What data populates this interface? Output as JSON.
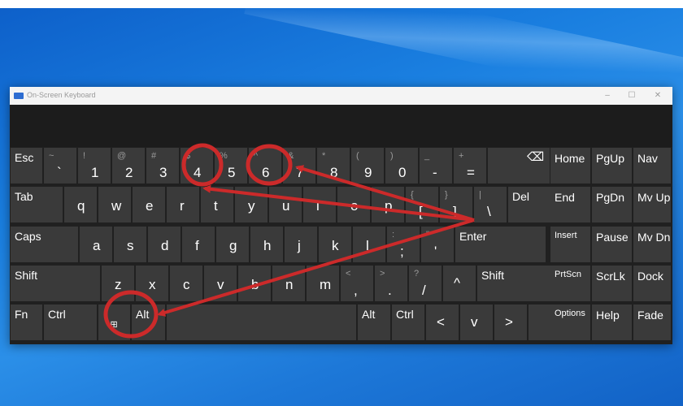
{
  "window": {
    "title": "On-Screen Keyboard",
    "minimize": "–",
    "maximize": "☐",
    "close": "✕"
  },
  "rows": {
    "r1": [
      {
        "name": "key-esc",
        "main": "Esc"
      },
      {
        "name": "key-backtick",
        "main": "`",
        "shift": "~"
      },
      {
        "name": "key-1",
        "main": "1",
        "shift": "!"
      },
      {
        "name": "key-2",
        "main": "2",
        "shift": "@"
      },
      {
        "name": "key-3",
        "main": "3",
        "shift": "#"
      },
      {
        "name": "key-4",
        "main": "4",
        "shift": "$"
      },
      {
        "name": "key-5",
        "main": "5",
        "shift": "%"
      },
      {
        "name": "key-6",
        "main": "6",
        "shift": "^"
      },
      {
        "name": "key-7",
        "main": "7",
        "shift": "&"
      },
      {
        "name": "key-8",
        "main": "8",
        "shift": "*"
      },
      {
        "name": "key-9",
        "main": "9",
        "shift": "("
      },
      {
        "name": "key-0",
        "main": "0",
        "shift": ")"
      },
      {
        "name": "key-minus",
        "main": "-",
        "shift": "_"
      },
      {
        "name": "key-equals",
        "main": "=",
        "shift": "+"
      },
      {
        "name": "key-backspace",
        "icon": "backspace-icon",
        "main": "⌫"
      }
    ],
    "r2": [
      {
        "name": "key-tab",
        "main": "Tab"
      },
      {
        "name": "key-q",
        "main": "q"
      },
      {
        "name": "key-w",
        "main": "w"
      },
      {
        "name": "key-e",
        "main": "e"
      },
      {
        "name": "key-r",
        "main": "r"
      },
      {
        "name": "key-t",
        "main": "t"
      },
      {
        "name": "key-y",
        "main": "y"
      },
      {
        "name": "key-u",
        "main": "u"
      },
      {
        "name": "key-i",
        "main": "i"
      },
      {
        "name": "key-o",
        "main": "o"
      },
      {
        "name": "key-p",
        "main": "p"
      },
      {
        "name": "key-open-bracket",
        "main": "[",
        "shift": "{"
      },
      {
        "name": "key-close-bracket",
        "main": "]",
        "shift": "}"
      },
      {
        "name": "key-backslash",
        "main": "\\",
        "shift": "|"
      },
      {
        "name": "key-del",
        "main": "Del"
      }
    ],
    "r3": [
      {
        "name": "key-caps",
        "main": "Caps"
      },
      {
        "name": "key-a",
        "main": "a"
      },
      {
        "name": "key-s",
        "main": "s"
      },
      {
        "name": "key-d",
        "main": "d"
      },
      {
        "name": "key-f",
        "main": "f"
      },
      {
        "name": "key-g",
        "main": "g"
      },
      {
        "name": "key-h",
        "main": "h"
      },
      {
        "name": "key-j",
        "main": "j"
      },
      {
        "name": "key-k",
        "main": "k"
      },
      {
        "name": "key-l",
        "main": "l"
      },
      {
        "name": "key-semicolon",
        "main": ";",
        "shift": ":"
      },
      {
        "name": "key-quote",
        "main": "'",
        "shift": "\""
      },
      {
        "name": "key-enter",
        "main": "Enter"
      }
    ],
    "r4": [
      {
        "name": "key-shift-left",
        "main": "Shift"
      },
      {
        "name": "key-z",
        "main": "z"
      },
      {
        "name": "key-x",
        "main": "x"
      },
      {
        "name": "key-c",
        "main": "c"
      },
      {
        "name": "key-v",
        "main": "v"
      },
      {
        "name": "key-b",
        "main": "b"
      },
      {
        "name": "key-n",
        "main": "n"
      },
      {
        "name": "key-m",
        "main": "m"
      },
      {
        "name": "key-comma",
        "main": ",",
        "shift": "<"
      },
      {
        "name": "key-period",
        "main": ".",
        "shift": ">"
      },
      {
        "name": "key-slash",
        "main": "/",
        "shift": "?"
      },
      {
        "name": "key-up",
        "icon": "arrow-up-icon",
        "main": "^"
      },
      {
        "name": "key-shift-right",
        "main": "Shift"
      }
    ],
    "r5": [
      {
        "name": "key-fn",
        "main": "Fn"
      },
      {
        "name": "key-ctrl-left",
        "main": "Ctrl"
      },
      {
        "name": "key-windows",
        "icon": "windows-logo-icon",
        "main": "⊞"
      },
      {
        "name": "key-alt-left",
        "main": "Alt"
      },
      {
        "name": "key-space",
        "main": ""
      },
      {
        "name": "key-alt-right",
        "main": "Alt"
      },
      {
        "name": "key-ctrl-right",
        "main": "Ctrl"
      },
      {
        "name": "key-left",
        "icon": "arrow-left-icon",
        "main": "<"
      },
      {
        "name": "key-down",
        "icon": "arrow-down-icon",
        "main": "v"
      },
      {
        "name": "key-right",
        "icon": "arrow-right-icon",
        "main": ">"
      },
      {
        "name": "key-menu",
        "icon": "context-menu-icon",
        "main": "▤"
      }
    ]
  },
  "nav": [
    [
      "Home",
      "PgUp",
      "Nav"
    ],
    [
      "End",
      "PgDn",
      "Mv Up"
    ],
    [
      "Insert",
      "Pause",
      "Mv Dn"
    ],
    [
      "PrtScn",
      "ScrLk",
      "Dock"
    ],
    [
      "Options",
      "Help",
      "Fade"
    ]
  ],
  "annotations": {
    "color": "#cc2a2a",
    "circled_keys": [
      "4",
      "6",
      "Alt"
    ],
    "arrow_origin": "key-backslash"
  }
}
